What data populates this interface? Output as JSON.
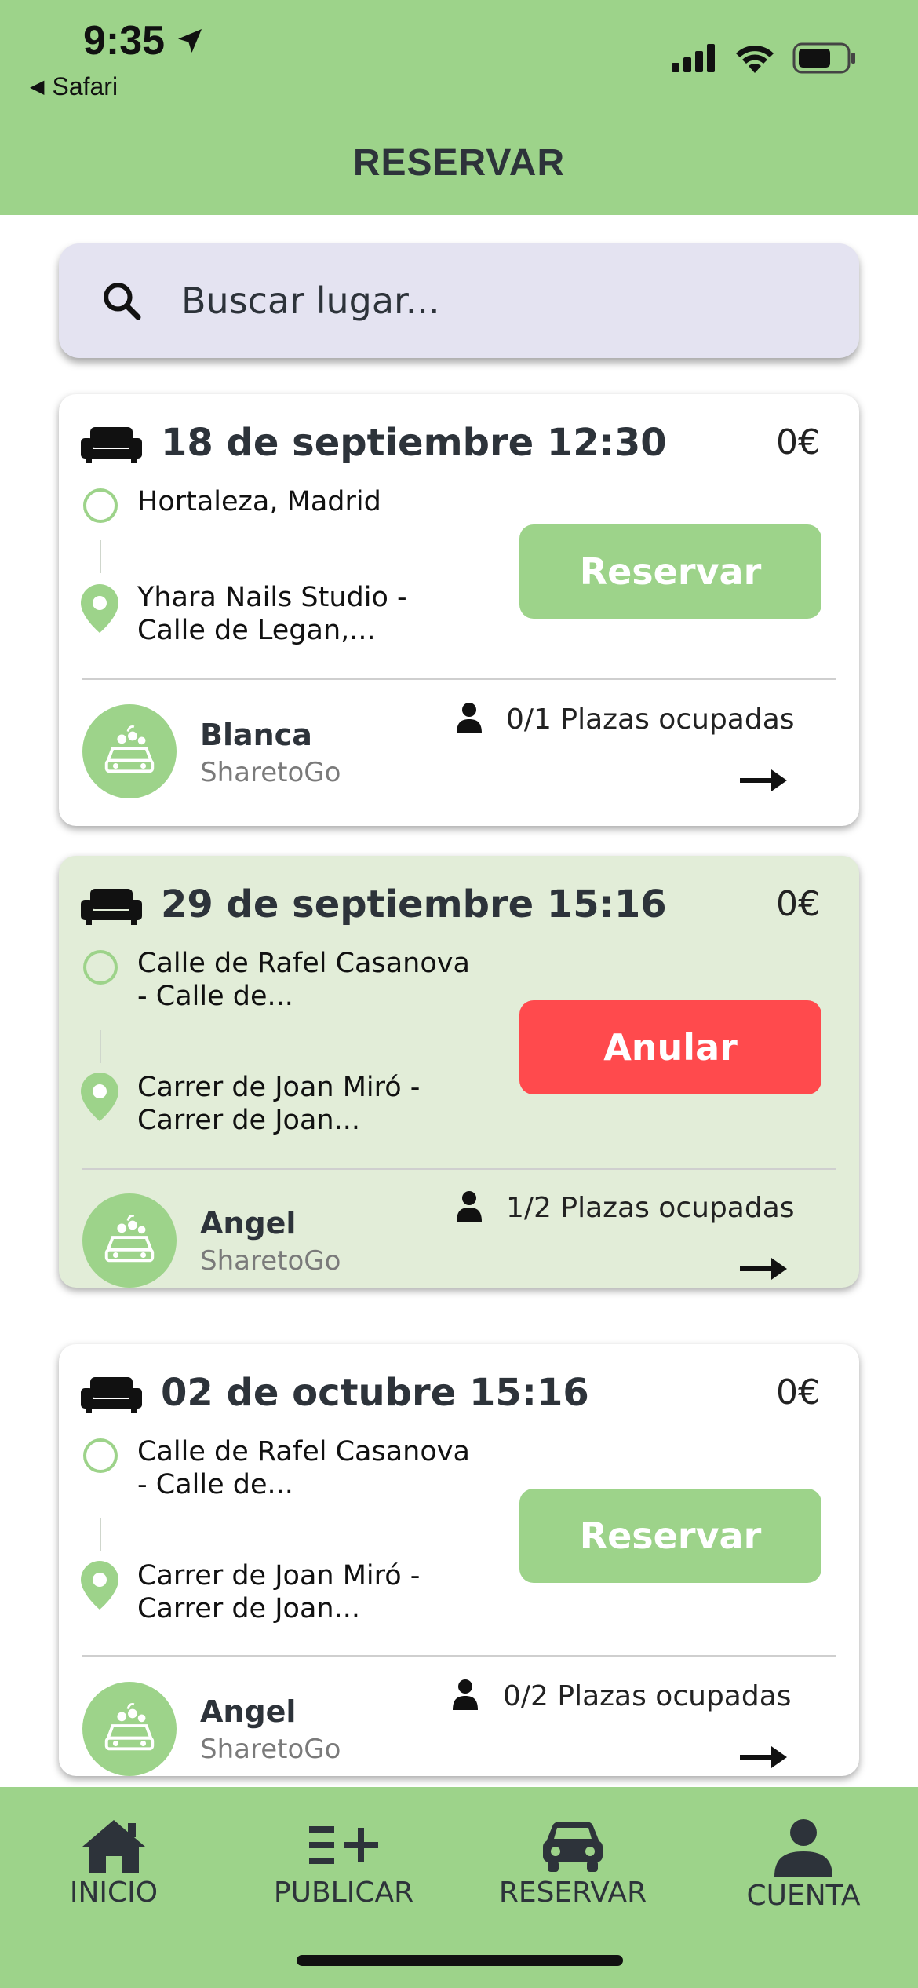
{
  "status": {
    "time": "9:35",
    "back_label": "Safari"
  },
  "header": {
    "title": "RESERVAR"
  },
  "search": {
    "placeholder": "Buscar lugar..."
  },
  "trips": [
    {
      "date": "18 de septiembre 12:30",
      "price": "0€",
      "origin": "Hortaleza, Madrid",
      "destination": "Yhara Nails Studio -\nCalle de Legan,...",
      "action": "Reservar",
      "driver": "Blanca",
      "org": "SharetoGo",
      "seats": "0/1 Plazas ocupadas"
    },
    {
      "date": "29 de septiembre 15:16",
      "price": "0€",
      "origin": "Calle de Rafel Casanova\n- Calle de...",
      "destination": "Carrer de Joan Miró -\nCarrer de Joan...",
      "action": "Anular",
      "driver": "Angel",
      "org": "SharetoGo",
      "seats": "1/2 Plazas ocupadas"
    },
    {
      "date": "02 de octubre 15:16",
      "price": "0€",
      "origin": "Calle de Rafel Casanova\n- Calle de...",
      "destination": "Carrer de Joan Miró -\nCarrer de Joan...",
      "action": "Reservar",
      "driver": "Angel",
      "org": "SharetoGo",
      "seats": "0/2 Plazas ocupadas"
    }
  ],
  "nav": {
    "inicio": "INICIO",
    "publicar": "PUBLICAR",
    "reservar": "RESERVAR",
    "cuenta": "CUENTA"
  },
  "colors": {
    "brand_green": "#9dd38a",
    "booked_bg": "#e2edd8",
    "cancel_red": "#ff4a4d",
    "search_bg": "#e4e3f1"
  }
}
